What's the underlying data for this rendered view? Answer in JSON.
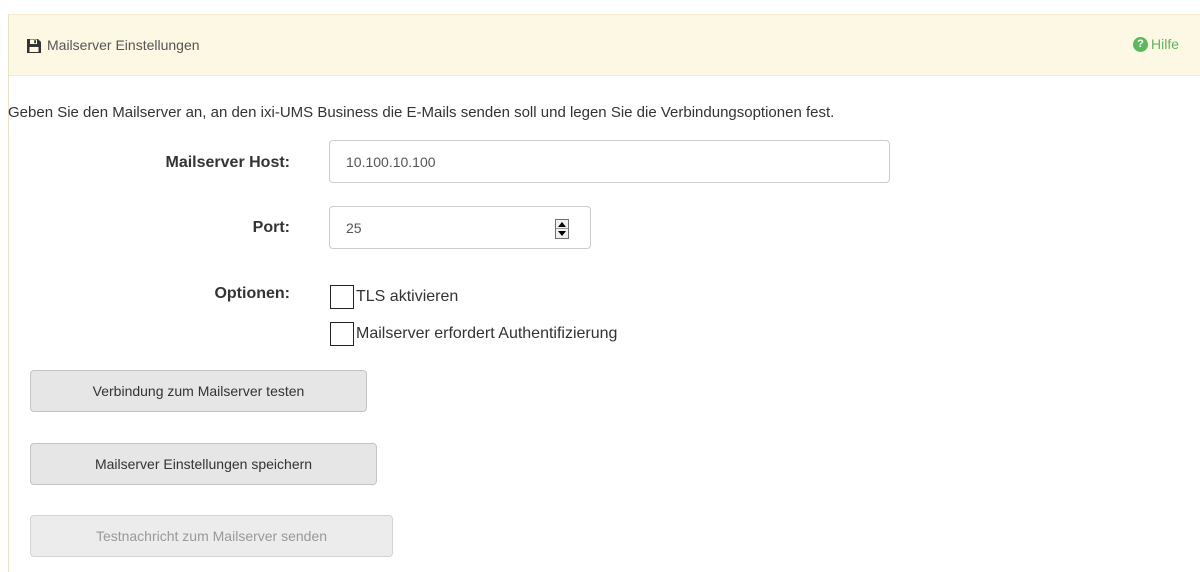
{
  "panel": {
    "title": "Mailserver Einstellungen",
    "title_icon": "save-icon",
    "help_label": "Hilfe",
    "help_icon": "question-circle-icon",
    "header_bg": "#fcf8e3",
    "accent_green": "#5cb85c"
  },
  "intro_text": "Geben Sie den Mailserver an, an den ixi-UMS Business die E-Mails senden soll und legen Sie die Verbindungsoptionen fest.",
  "form": {
    "host_label": "Mailserver Host:",
    "host_value": "10.100.10.100",
    "port_label": "Port:",
    "port_value": "25",
    "options_label": "Optionen:",
    "options": [
      {
        "label": "TLS aktivieren",
        "checked": false
      },
      {
        "label": "Mailserver erfordert Authentifizierung",
        "checked": false
      }
    ]
  },
  "buttons": {
    "test": "Verbindung zum Mailserver testen",
    "save": "Mailserver Einstellungen speichern",
    "send": "Testnachricht zum Mailserver senden"
  }
}
